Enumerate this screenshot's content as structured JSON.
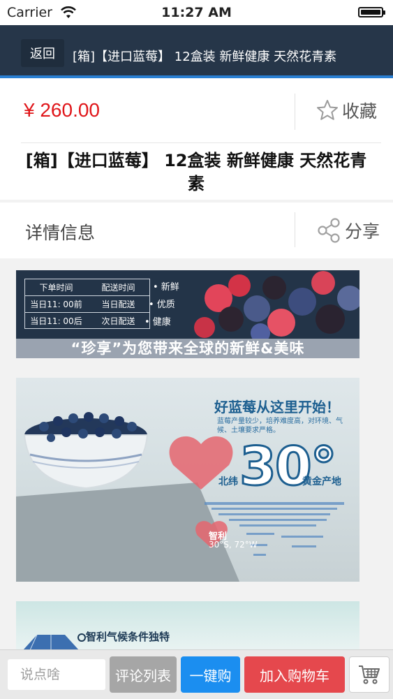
{
  "status_bar": {
    "carrier": "Carrier",
    "time": "11:27 AM"
  },
  "nav": {
    "back_label": "返回",
    "title": "[箱]【进口蓝莓】 12盒装 新鲜健康 天然花青素"
  },
  "product": {
    "price": "¥ 260.00",
    "favorite_label": "收藏",
    "title": "[箱]【进口蓝莓】 12盒装 新鲜健康 天然花青素"
  },
  "details": {
    "label": "详情信息",
    "share_label": "分享"
  },
  "banner1": {
    "table_headers": [
      "下单时间",
      "配送时间"
    ],
    "table_rows": [
      [
        "当日11: 00前",
        "当日配送"
      ],
      [
        "当日11: 00后",
        "次日配送"
      ]
    ],
    "bullets": [
      "• 新鲜",
      "• 优质",
      "• 健康"
    ],
    "slogan": "“珍享”为您带来全球的新鲜&美味"
  },
  "banner2": {
    "heading": "好蓝莓从这里开始！",
    "description": "蓝莓产量较少，培养难度高，对环境、气候、土壤要求严格。",
    "north_label": "北纬",
    "latitude": "30°",
    "golden_label": "黄金产地",
    "chile_label": "智利",
    "chile_coord": "30°S, 72°W"
  },
  "banner3": {
    "heading": "智利气候条件独特"
  },
  "bottom_bar": {
    "comment_placeholder": "说点啥",
    "reviews_label": "评论列表",
    "buy_now_label": "一键购",
    "add_to_cart_label": "加入购物车"
  },
  "colors": {
    "nav_bg": "#263649",
    "nav_accent": "#2a7fd2",
    "price_red": "#e0161a",
    "buy_now_blue": "#1b8ef0",
    "add_cart_red": "#e5484d",
    "reviews_gray": "#a6a6a6"
  },
  "icons": {
    "favorite": "star-outline-icon",
    "share": "share-icon",
    "cart": "shopping-cart-icon",
    "wifi": "wifi-icon",
    "battery": "battery-icon"
  }
}
